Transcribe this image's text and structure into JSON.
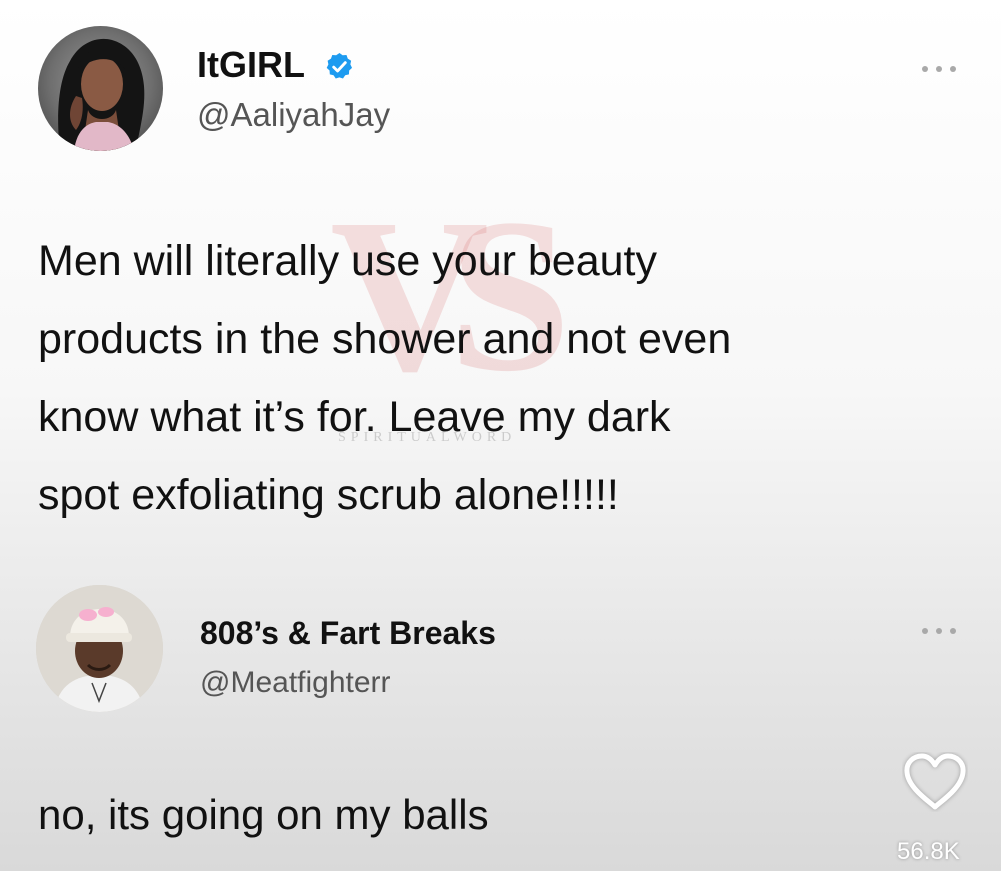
{
  "watermark": {
    "caption": "SPIRITUALWORD"
  },
  "tweet": {
    "display_name": "ItGIRL",
    "handle": "@AaliyahJay",
    "verified_icon": "verified-badge-icon",
    "more_icon": "more-options-icon",
    "text": "Men will literally use your beauty\nproducts in the shower and not even\nknow what it’s for. Leave my dark\nspot exfoliating scrub alone!!!!!"
  },
  "reply": {
    "display_name": "808’s & Fart Breaks",
    "handle": "@Meatfighterr",
    "more_icon": "more-options-icon",
    "text": "no, its going on my balls"
  },
  "overlay": {
    "like_icon": "heart-icon",
    "like_count": "56.8K"
  },
  "colors": {
    "verified": "#1d9bf0",
    "handle": "#555555",
    "text": "#111111"
  }
}
